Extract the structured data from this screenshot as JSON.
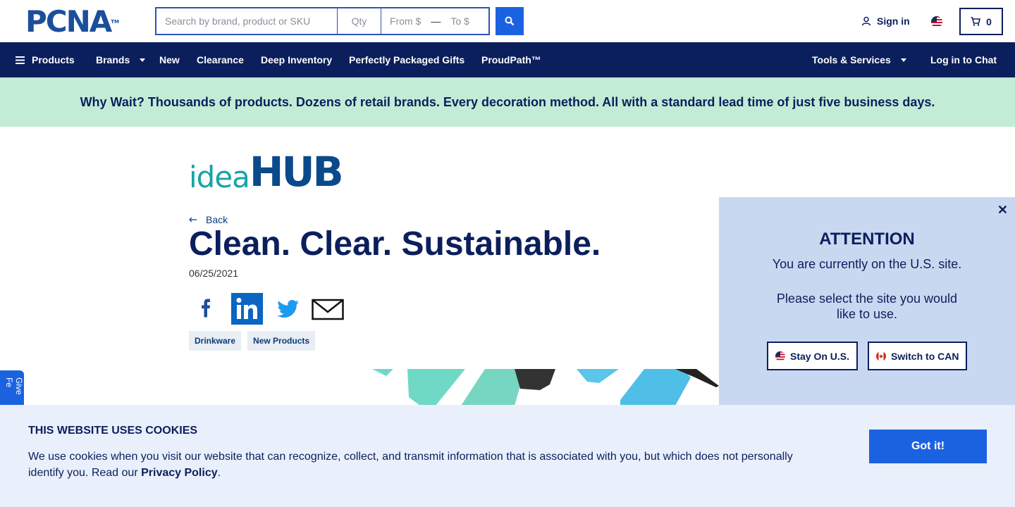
{
  "header": {
    "logo_text": "PCNA",
    "logo_tm": "TM",
    "search": {
      "placeholder": "Search by brand, product or SKU",
      "qty_placeholder": "Qty",
      "price_from": "From $",
      "price_dash": "—",
      "price_to": "To $"
    },
    "sign_in": "Sign in",
    "cart_count": "0"
  },
  "nav": {
    "products": "Products",
    "brands": "Brands",
    "new": "New",
    "clearance": "Clearance",
    "deep_inventory": "Deep Inventory",
    "gifts": "Perfectly Packaged Gifts",
    "proudpath": "ProudPath™",
    "tools": "Tools & Services",
    "chat": "Log in to Chat"
  },
  "promo": "Why Wait? Thousands of products. Dozens of retail brands. Every decoration method. All with a standard lead time of just five business days.",
  "article": {
    "brand_idea": "idea",
    "brand_hub": "HUB",
    "back": "Back",
    "title": "Clean. Clear. Sustainable.",
    "date": "06/25/2021",
    "tags": [
      "Drinkware",
      "New Products"
    ]
  },
  "modal": {
    "heading": "ATTENTION",
    "line1": "You are currently on the U.S. site.",
    "line2": "Please select the site you would like to use.",
    "stay": "Stay On U.S.",
    "switch": "Switch to CAN"
  },
  "feedback": "Give Fe",
  "cookies": {
    "heading": "THIS WEBSITE USES COOKIES",
    "text": "We use cookies when you visit our website that can recognize, collect, and transmit information that is associated with you, but which does not personally identify you. Read our ",
    "policy": "Privacy Policy",
    "period": ".",
    "button": "Got it!"
  },
  "colors": {
    "navy": "#0b1f5c",
    "blue": "#1b62e0",
    "promo_bg": "#c3ecd6",
    "modal_bg": "#c8d8f0"
  }
}
